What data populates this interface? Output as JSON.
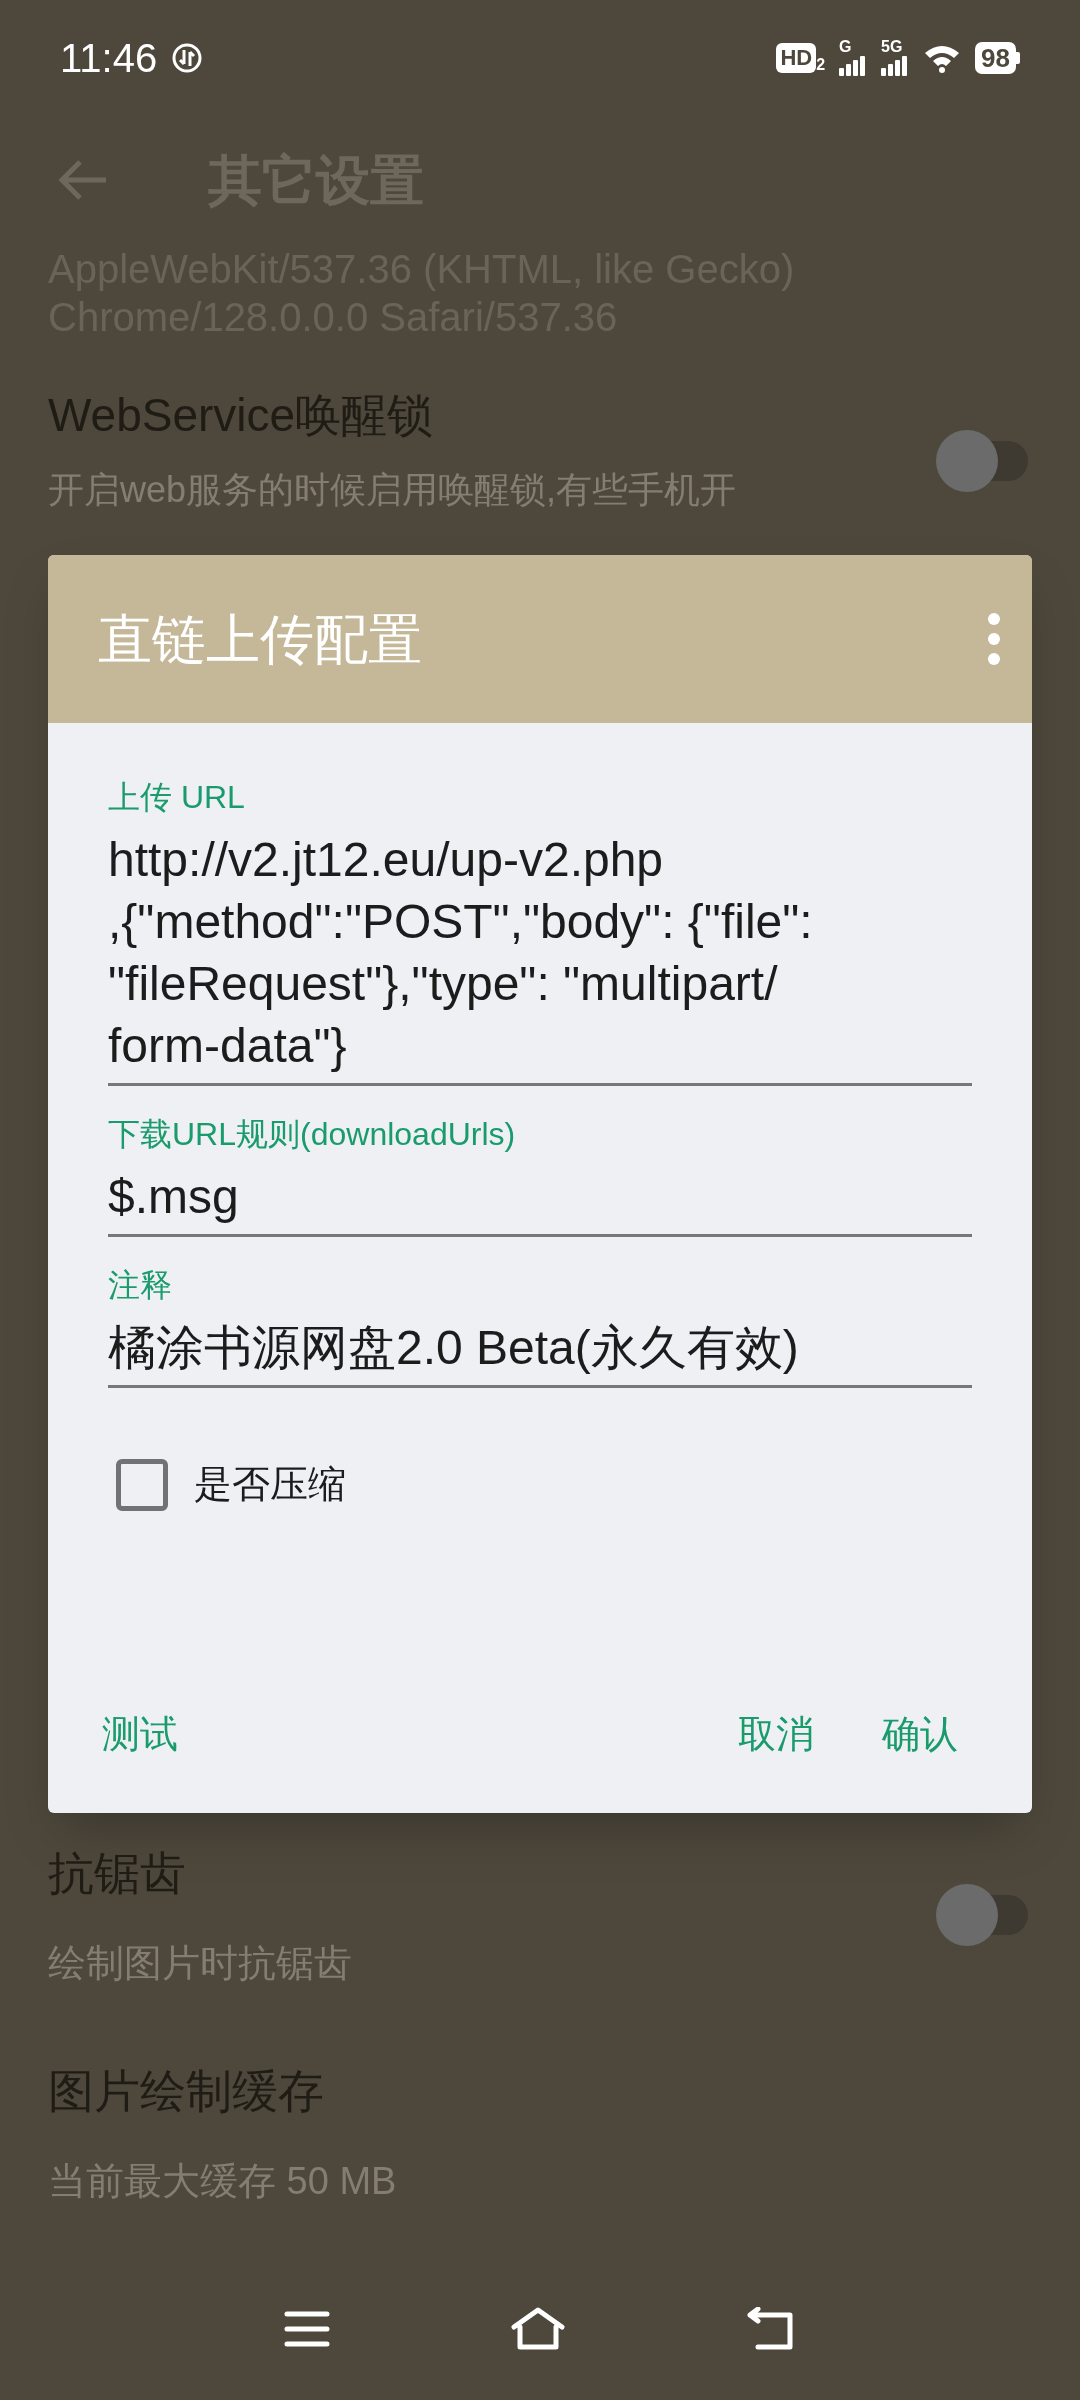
{
  "status_bar": {
    "time": "11:46",
    "hd_badge": "HD",
    "hd_sub": "2",
    "network_1": "G",
    "network_2": "5G",
    "battery": "98"
  },
  "app_bar": {
    "title": "其它设置"
  },
  "settings_top": {
    "user_agent_lines": [
      "AppleWebKit/537.36 (KHTML, like Gecko)",
      "Chrome/128.0.0.0 Safari/537.36"
    ],
    "title": "WebService唤醒锁",
    "subtitle": "开启web服务的时候启用唤醒锁,有些手机开",
    "on": false
  },
  "dialog": {
    "title": "直链上传配置",
    "fields": [
      {
        "label": "上传 URL",
        "value": "http://v2.jt12.eu/up-v2.php\n,{\"method\":\"POST\",\"body\": {\"file\":\n\"fileRequest\"},\"type\": \"multipart/\nform-data\"}"
      },
      {
        "label": "下载URL规则(downloadUrls)",
        "value": "$.msg"
      },
      {
        "label": "注释",
        "value": "橘涂书源网盘2.0 Beta(永久有效)"
      }
    ],
    "checkbox": {
      "label": "是否压缩",
      "checked": false
    },
    "buttons": [
      {
        "label": "测试",
        "kind": "left"
      },
      {
        "label": "取消",
        "kind": "right"
      },
      {
        "label": "确认",
        "kind": "right"
      }
    ]
  },
  "settings_bottom": [
    {
      "title": "抗锯齿",
      "subtitle": "绘制图片时抗锯齿",
      "kind": "switch",
      "on": false
    },
    {
      "title": "图片绘制缓存",
      "subtitle": "当前最大缓存 50 MB",
      "kind": "plain"
    }
  ]
}
